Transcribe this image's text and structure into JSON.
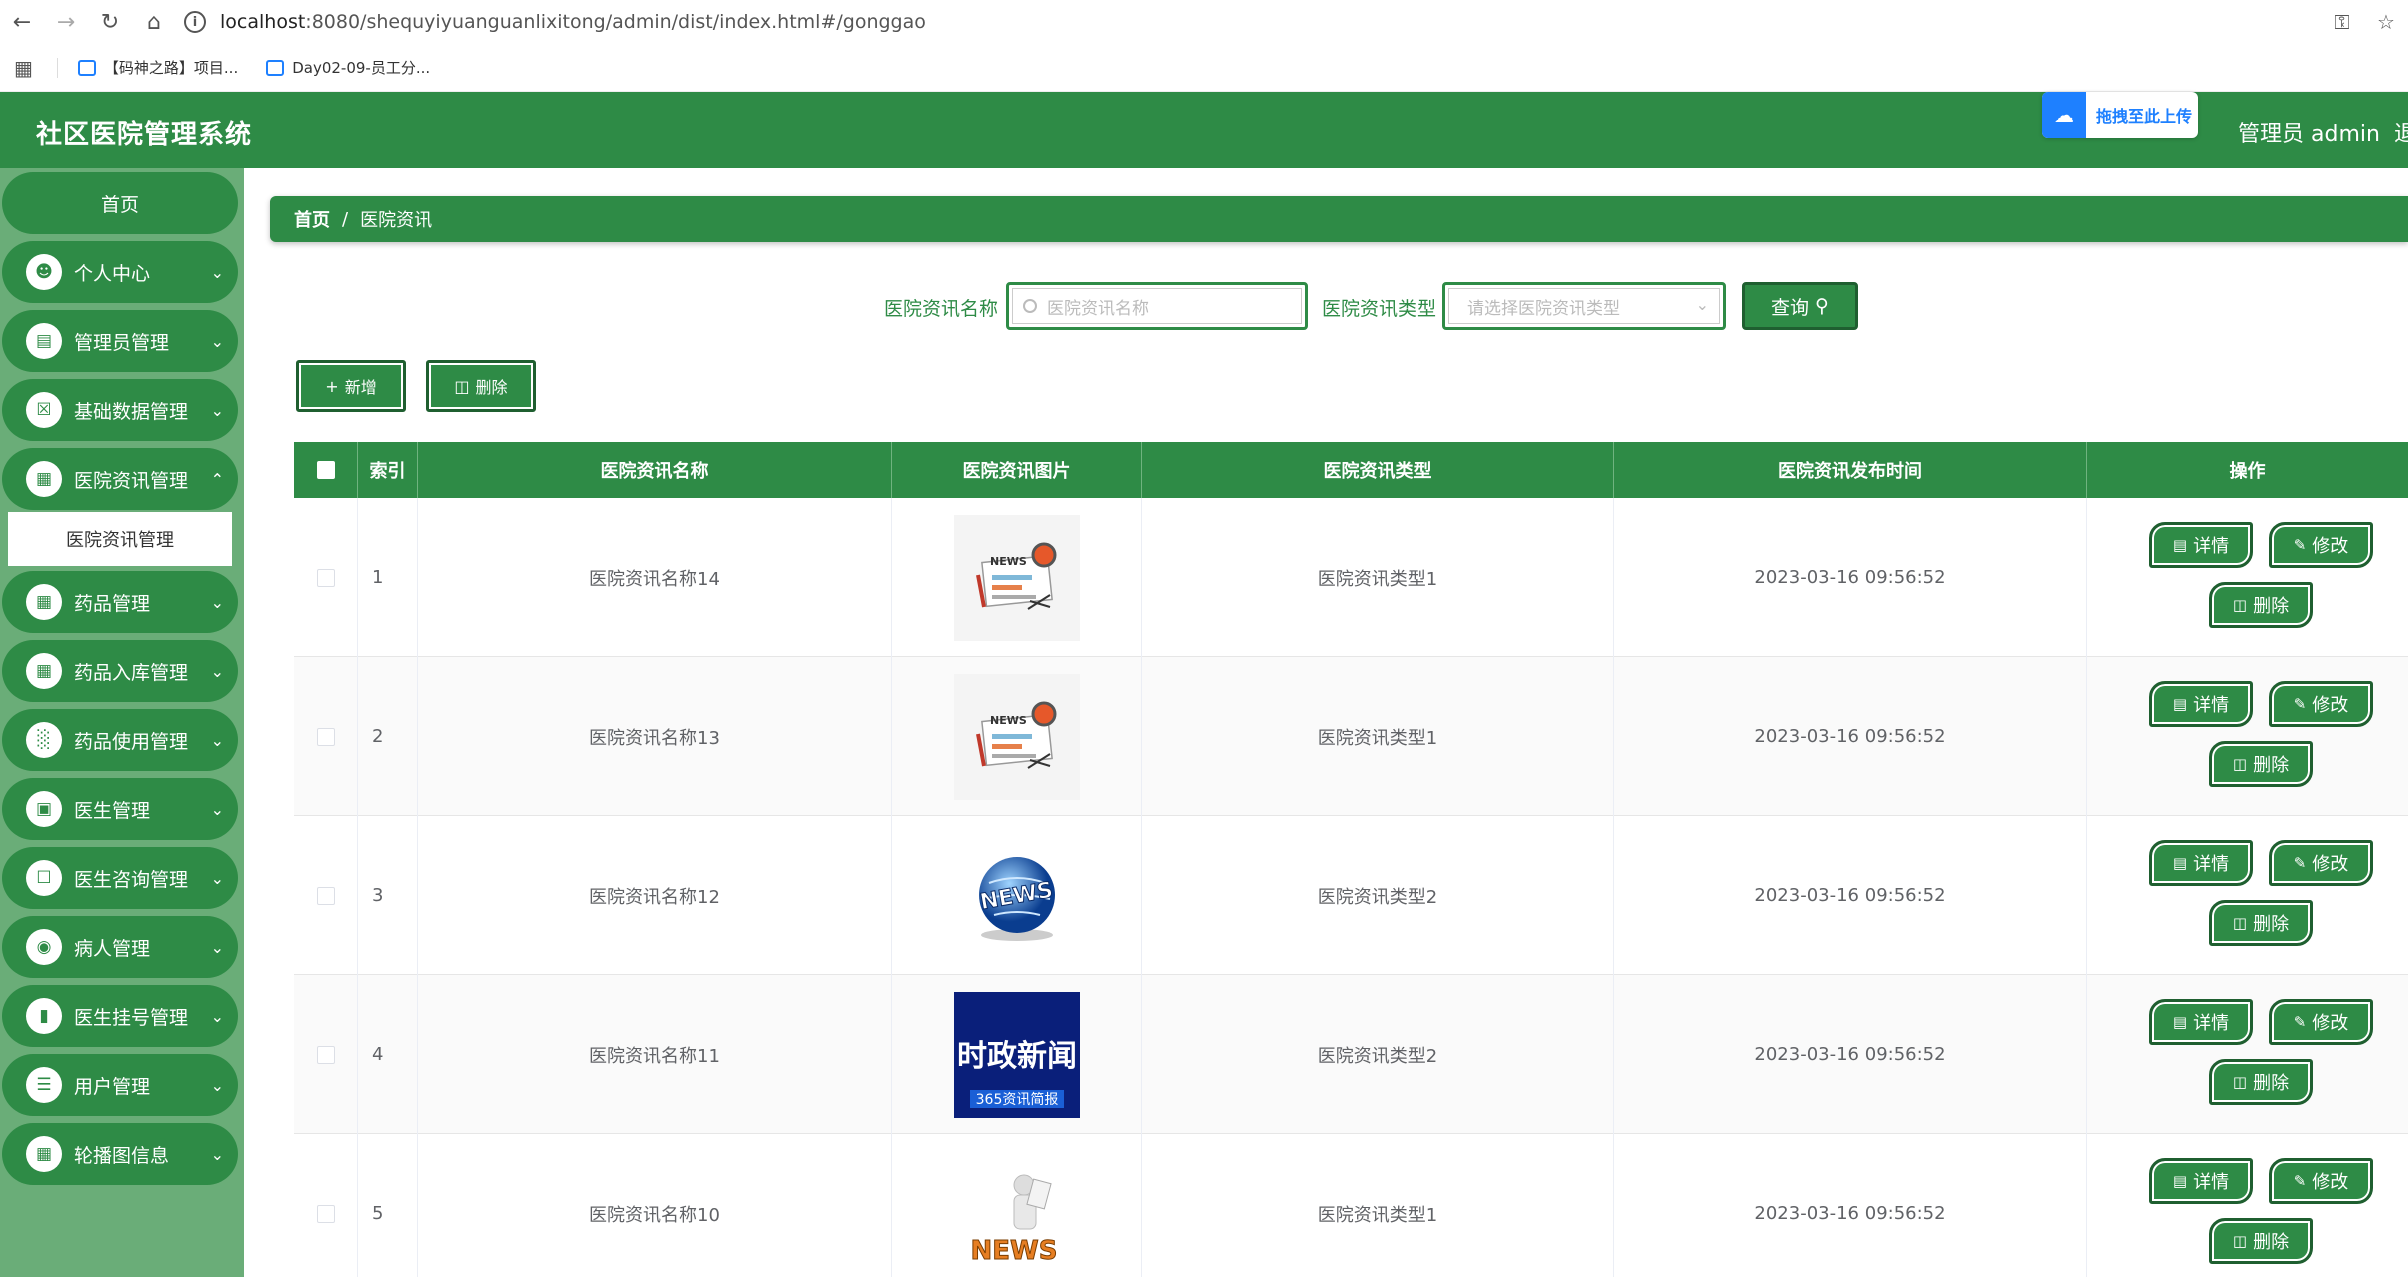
{
  "browser": {
    "url_host": "localhost",
    "url_path": ":8080/shequyiyuanguanlixitong/admin/dist/index.html#/gonggao",
    "bookmarks": [
      "【码神之路】项目...",
      "Day02-09-员工分..."
    ]
  },
  "header": {
    "title": "社区医院管理系统",
    "upload_label": "拖拽至此上传",
    "user_label": "管理员 admin",
    "logout_label": "退"
  },
  "sidebar": {
    "home": "首页",
    "items": [
      {
        "label": "个人中心",
        "icon": "user-icon"
      },
      {
        "label": "管理员管理",
        "icon": "chart-icon"
      },
      {
        "label": "基础数据管理",
        "icon": "clipboard-icon"
      },
      {
        "label": "医院资讯管理",
        "icon": "grid-icon"
      },
      {
        "label": "药品管理",
        "icon": "grid-icon"
      },
      {
        "label": "药品入库管理",
        "icon": "grid-icon"
      },
      {
        "label": "药品使用管理",
        "icon": "bar-chart-icon"
      },
      {
        "label": "医生管理",
        "icon": "briefcase-icon"
      },
      {
        "label": "医生咨询管理",
        "icon": "ticket-icon"
      },
      {
        "label": "病人管理",
        "icon": "location-icon"
      },
      {
        "label": "医生挂号管理",
        "icon": "book-icon"
      },
      {
        "label": "用户管理",
        "icon": "list-icon"
      },
      {
        "label": "轮播图信息",
        "icon": "grid-icon"
      }
    ],
    "active_submenu": "医院资讯管理"
  },
  "breadcrumb": {
    "home": "首页",
    "sep": "/",
    "current": "医院资讯"
  },
  "search": {
    "name_label": "医院资讯名称",
    "name_placeholder": "医院资讯名称",
    "type_label": "医院资讯类型",
    "type_placeholder": "请选择医院资讯类型",
    "query_label": "查询"
  },
  "toolbar": {
    "add_label": "新增",
    "delete_label": "删除"
  },
  "table": {
    "headers": [
      "索引",
      "医院资讯名称",
      "医院资讯图片",
      "医院资讯类型",
      "医院资讯发布时间",
      "操作"
    ],
    "rows": [
      {
        "index": "1",
        "name": "医院资讯名称14",
        "image": "news-paper",
        "type": "医院资讯类型1",
        "time": "2023-03-16 09:56:52"
      },
      {
        "index": "2",
        "name": "医院资讯名称13",
        "image": "news-paper",
        "type": "医院资讯类型1",
        "time": "2023-03-16 09:56:52"
      },
      {
        "index": "3",
        "name": "医院资讯名称12",
        "image": "news-globe",
        "type": "医院资讯类型2",
        "time": "2023-03-16 09:56:52"
      },
      {
        "index": "4",
        "name": "医院资讯名称11",
        "image": "news-banner",
        "type": "医院资讯类型2",
        "time": "2023-03-16 09:56:52"
      },
      {
        "index": "5",
        "name": "医院资讯名称10",
        "image": "news-figure",
        "type": "医院资讯类型1",
        "time": "2023-03-16 09:56:52"
      }
    ],
    "actions": {
      "detail": "详情",
      "edit": "修改",
      "delete": "删除"
    }
  },
  "images": {
    "paper_word": "NEWS",
    "globe_word": "NEWS",
    "banner_title": "时政新闻",
    "banner_sub": "365资讯简报",
    "figure_word": "NEWS"
  },
  "colors": {
    "primary": "#2e8b46",
    "sidebar_bg": "#6aad78",
    "border_dark": "#1f5f30"
  }
}
